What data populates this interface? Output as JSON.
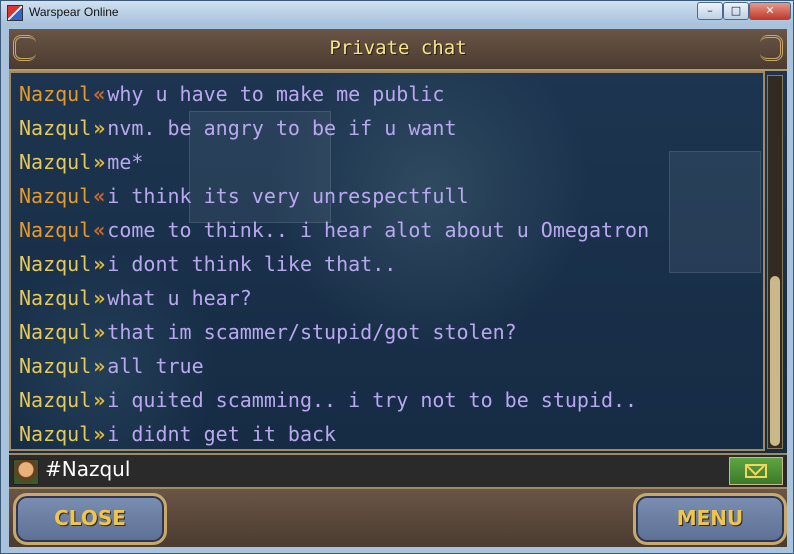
{
  "window": {
    "title": "Warspear Online",
    "controls": {
      "minimize": "–",
      "maximize": "□",
      "close": "✕"
    }
  },
  "header": {
    "title": "Private chat"
  },
  "messages": [
    {
      "sender": "Nazqul",
      "direction": "in",
      "arrow": "«",
      "text": "why u have to make me public"
    },
    {
      "sender": "Nazqul",
      "direction": "out",
      "arrow": "»",
      "text": "nvm. be angry to be if u want"
    },
    {
      "sender": "Nazqul",
      "direction": "out",
      "arrow": "»",
      "text": "me*"
    },
    {
      "sender": "Nazqul",
      "direction": "in",
      "arrow": "«",
      "text": "i think its very unrespectfull"
    },
    {
      "sender": "Nazqul",
      "direction": "in",
      "arrow": "«",
      "text": "come to think.. i hear alot about u Omegatron"
    },
    {
      "sender": "Nazqul",
      "direction": "out",
      "arrow": "»",
      "text": "i dont think like that.."
    },
    {
      "sender": "Nazqul",
      "direction": "out",
      "arrow": "»",
      "text": "what u hear?"
    },
    {
      "sender": "Nazqul",
      "direction": "out",
      "arrow": "»",
      "text": "that im scammer/stupid/got stolen?"
    },
    {
      "sender": "Nazqul",
      "direction": "out",
      "arrow": "»",
      "text": "all true"
    },
    {
      "sender": "Nazqul",
      "direction": "out",
      "arrow": "»",
      "text": "i quited scamming.. i try not to be stupid.."
    },
    {
      "sender": "Nazqul",
      "direction": "out",
      "arrow": "»",
      "text": "i didnt get it back"
    }
  ],
  "input": {
    "recipient": "#Nazqul",
    "send_icon": "envelope-icon"
  },
  "footer": {
    "left_button": "CLOSE",
    "right_button": "MENU"
  },
  "colors": {
    "incoming_name": "#e59a2a",
    "outgoing_name": "#e5c95a",
    "message_text": "#b9a8f0",
    "title": "#f6e58b",
    "button_text": "#f0c64a"
  }
}
